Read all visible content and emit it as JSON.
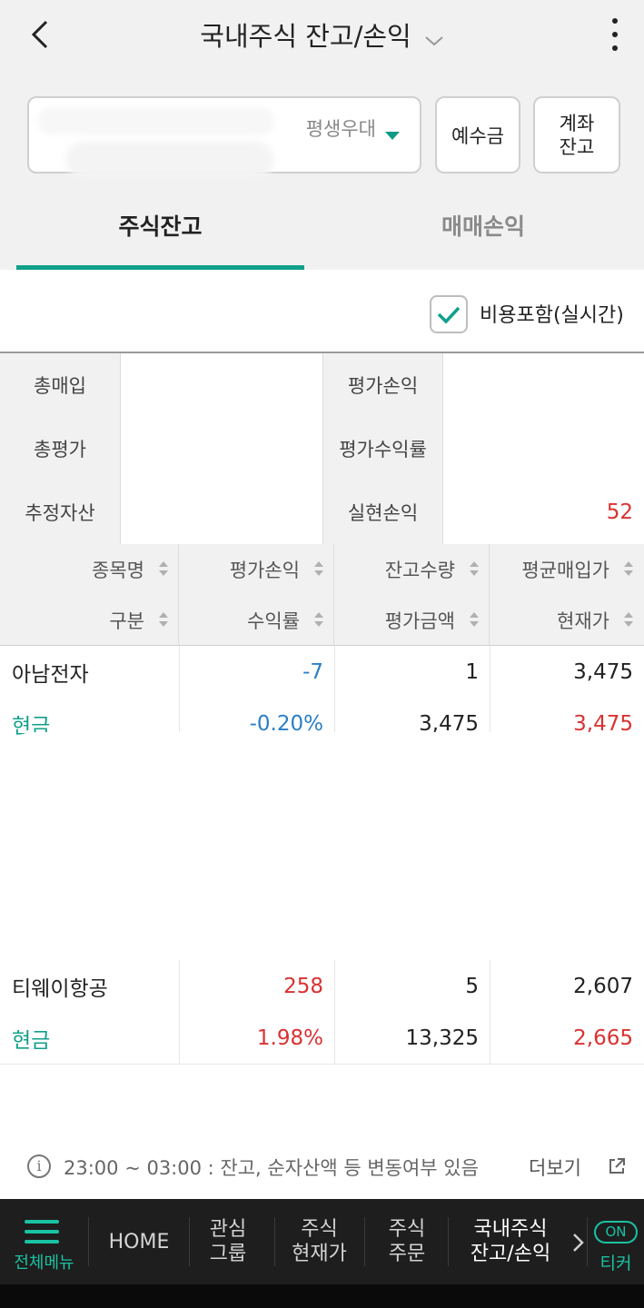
{
  "header": {
    "title": "국내주식 잔고/손익",
    "back_icon": "chevron-left-icon",
    "dropdown_icon": "chevron-down-icon",
    "more_icon": "more-vertical-icon"
  },
  "account": {
    "name": "평생우대",
    "deposit_button": "예수금",
    "balance_button": "계좌\n잔고"
  },
  "tabs": [
    {
      "label": "주식잔고",
      "active": true
    },
    {
      "label": "매매손익",
      "active": false
    }
  ],
  "options": {
    "include_cost_label": "비용포함(실시간)",
    "include_cost_checked": true
  },
  "summary": {
    "rows": [
      {
        "label1": "총매입",
        "value1": "",
        "label2": "평가손익",
        "value2": ""
      },
      {
        "label1": "총평가",
        "value1": "",
        "label2": "평가수익률",
        "value2": ""
      },
      {
        "label1": "추정자산",
        "value1": "",
        "label2": "실현손익",
        "value2": "52"
      }
    ]
  },
  "table": {
    "headers_top": [
      "종목명",
      "평가손익",
      "잔고수량",
      "평균매입가"
    ],
    "headers_bottom": [
      "구분",
      "수익률",
      "평가금액",
      "현재가"
    ],
    "rows": [
      {
        "name": "아남전자",
        "type": "현금",
        "pnl": "-7",
        "rate": "-0.20%",
        "qty": "1",
        "eval": "3,475",
        "avg": "3,475",
        "price": "3,475"
      },
      {
        "name": "티웨이항공",
        "type": "현금",
        "pnl": "258",
        "rate": "1.98%",
        "qty": "5",
        "eval": "13,325",
        "avg": "2,607",
        "price": "2,665"
      }
    ]
  },
  "notice": {
    "text": "23:00 ~ 03:00 : 잔고, 순자산액 등 변동여부 있음",
    "more": "더보기",
    "info_icon": "info-icon",
    "external_icon": "external-link-icon"
  },
  "bottom_nav": {
    "menu_label": "전체메뉴",
    "items": [
      "HOME",
      "관심\n그룹",
      "주식\n현재가",
      "주식\n주문",
      "국내주식\n잔고/손익"
    ],
    "on_badge": "ON",
    "ticker": "티커"
  },
  "colors": {
    "accent": "#11a08a",
    "up": "#d93232",
    "down": "#2a7fc8",
    "nav_bg": "#1e1e1e"
  }
}
